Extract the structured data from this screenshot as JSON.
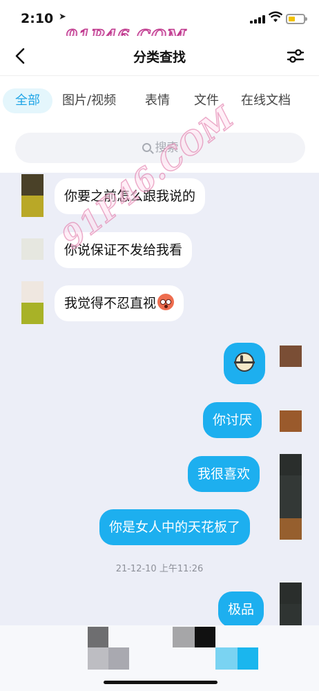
{
  "status_bar": {
    "time": "2:10",
    "location_icon": "location-arrow-icon",
    "battery_color": "#f2c200"
  },
  "watermark": {
    "text": "91P46.COM"
  },
  "navbar": {
    "title": "分类查找",
    "back_icon": "chevron-left-icon",
    "filter_icon": "sliders-icon"
  },
  "tabs": [
    {
      "label": "全部",
      "active": true
    },
    {
      "label": "图片/视频",
      "active": false
    },
    {
      "label": "表情",
      "active": false
    },
    {
      "label": "文件",
      "active": false
    },
    {
      "label": "在线文档",
      "active": false
    }
  ],
  "search": {
    "placeholder": "搜索"
  },
  "messages": [
    {
      "side": "in",
      "text": "你要之前怎么跟我说的"
    },
    {
      "side": "in",
      "text": "你说保证不发给我看"
    },
    {
      "side": "in",
      "text": "我觉得不忍直视",
      "emoji": "flushed-face-icon"
    },
    {
      "side": "out",
      "text": "",
      "sticker": "sticker-icon"
    },
    {
      "side": "out",
      "text": "你讨厌"
    },
    {
      "side": "out",
      "text": "我很喜欢"
    },
    {
      "side": "out",
      "text": "你是女人中的天花板了"
    },
    {
      "side": "out",
      "text": "极品"
    }
  ],
  "timestamp": "21-12-10 上午11:26",
  "colors": {
    "accent": "#1dafef",
    "tab_active_bg": "#e4f6fc",
    "chat_bg": "#eceef7"
  }
}
